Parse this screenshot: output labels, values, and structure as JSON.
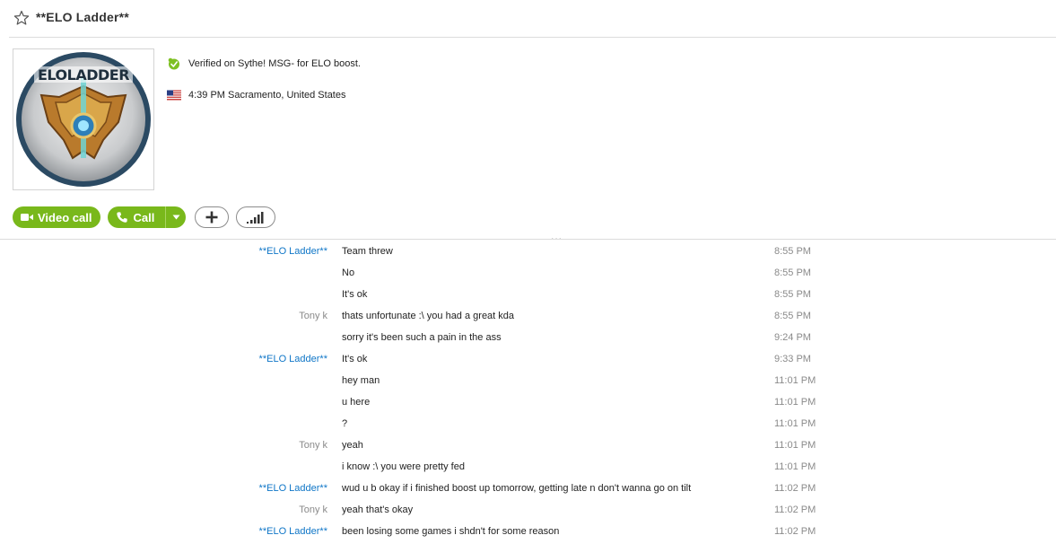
{
  "contact": {
    "name": "**ELO Ladder**",
    "mood_message": "Verified on Sythe! MSG- for ELO boost.",
    "local_time": "4:39 PM Sacramento, United States",
    "avatar_text": "ELOLADDER"
  },
  "actions": {
    "video_call_label": "Video call",
    "call_label": "Call"
  },
  "colors": {
    "accent_green": "#79b81b",
    "sender_self": "#0f76c7",
    "sender_other": "#8a8a8a"
  },
  "divider_label": "...",
  "messages": [
    {
      "sender": "**ELO Ladder**",
      "text": "Team threw",
      "time": "8:55 PM"
    },
    {
      "sender": "",
      "text": "No",
      "time": "8:55 PM"
    },
    {
      "sender": "",
      "text": "It's ok",
      "time": "8:55 PM"
    },
    {
      "sender": "Tony k",
      "text": "thats unfortunate :\\ you had a great kda",
      "time": "8:55 PM"
    },
    {
      "sender": "",
      "text": "sorry it's been such a pain in the ass",
      "time": "9:24 PM"
    },
    {
      "sender": "**ELO Ladder**",
      "text": "It's ok",
      "time": "9:33 PM"
    },
    {
      "sender": "",
      "text": "hey man",
      "time": "11:01 PM"
    },
    {
      "sender": "",
      "text": "u here",
      "time": "11:01 PM"
    },
    {
      "sender": "",
      "text": "?",
      "time": "11:01 PM"
    },
    {
      "sender": "Tony k",
      "text": "yeah",
      "time": "11:01 PM"
    },
    {
      "sender": "",
      "text": "i know :\\ you were pretty fed",
      "time": "11:01 PM"
    },
    {
      "sender": "**ELO Ladder**",
      "text": "wud u b okay if i finished boost up tomorrow, getting late n don't wanna go on tilt",
      "time": "11:02 PM"
    },
    {
      "sender": "Tony k",
      "text": "yeah that's okay",
      "time": "11:02 PM"
    },
    {
      "sender": "**ELO Ladder**",
      "text": "been losing some games i shdn't for some reason",
      "time": "11:02 PM"
    }
  ]
}
